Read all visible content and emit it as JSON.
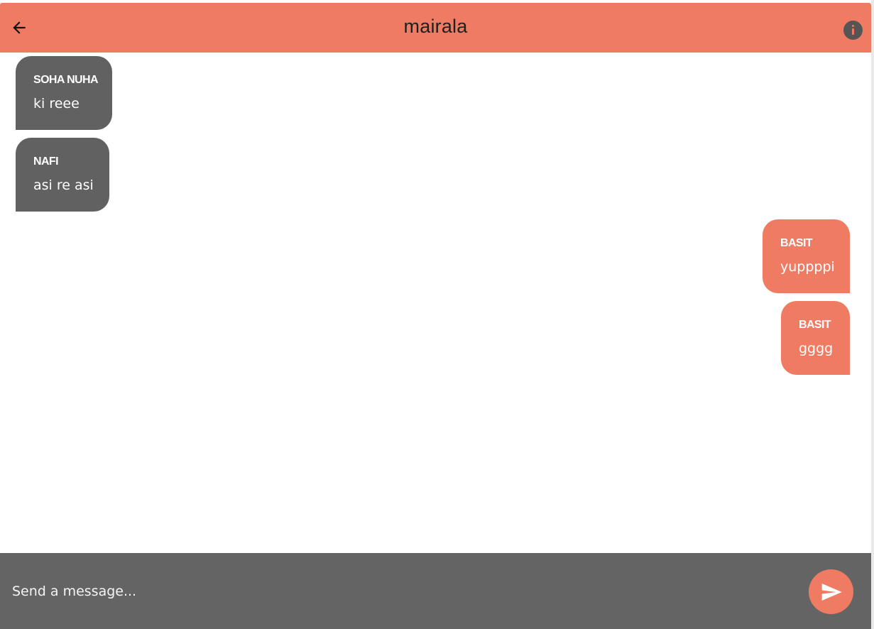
{
  "header": {
    "title": "mairala",
    "back_icon": "arrow-left-icon",
    "info_icon": "info-icon",
    "color": "#ef7b63"
  },
  "messages": [
    {
      "sender": "SOHA NUHA",
      "text": "ki reee",
      "direction": "incoming"
    },
    {
      "sender": "NAFI",
      "text": "asi re asi",
      "direction": "incoming"
    },
    {
      "sender": "BASIT",
      "text": "yuppppi",
      "direction": "outgoing"
    },
    {
      "sender": "BASIT",
      "text": "gggg",
      "direction": "outgoing"
    }
  ],
  "composer": {
    "placeholder": "Send a message...",
    "value": "",
    "send_icon": "send-icon"
  },
  "colors": {
    "accent": "#ef7b63",
    "incoming_bubble": "#616161",
    "composer_background": "#646464",
    "background": "#ffffff"
  }
}
